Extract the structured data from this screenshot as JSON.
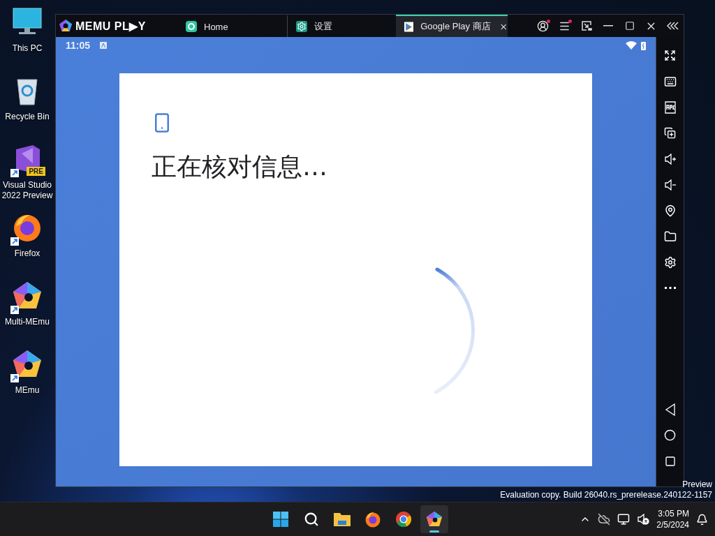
{
  "desktop_icons": [
    {
      "label": "This PC",
      "kind": "pc",
      "shortcut": false
    },
    {
      "label": "Recycle Bin",
      "kind": "bin",
      "shortcut": false
    },
    {
      "label": "Visual Studio 2022 Preview",
      "kind": "vs",
      "shortcut": true,
      "badge": "PRE"
    },
    {
      "label": "Firefox",
      "kind": "firefox",
      "shortcut": true
    },
    {
      "label": "Multi-MEmu",
      "kind": "multimemu",
      "shortcut": true
    },
    {
      "label": "MEmu",
      "kind": "memu",
      "shortcut": true
    }
  ],
  "emulator": {
    "logo": "MEMU PL▶Y",
    "tabs": [
      {
        "label": "Home",
        "kind": "home",
        "selected": false
      },
      {
        "label": "设置",
        "kind": "settings",
        "selected": false
      },
      {
        "label": "Google Play 商店",
        "kind": "play",
        "selected": true
      }
    ],
    "title_buttons": [
      {
        "kind": "account",
        "badge": true
      },
      {
        "kind": "menu",
        "badge": true
      },
      {
        "kind": "screen",
        "badge": false
      },
      {
        "kind": "minimize",
        "badge": false
      },
      {
        "kind": "maximize",
        "badge": false
      },
      {
        "kind": "close",
        "badge": false
      },
      {
        "kind": "collapse",
        "badge": false
      }
    ],
    "status_bar": {
      "time": "11:05"
    },
    "dialog": {
      "title": "正在核对信息…"
    },
    "tools": [
      {
        "kind": "fullscreen"
      },
      {
        "kind": "keyboard"
      },
      {
        "kind": "apk"
      },
      {
        "kind": "multi"
      },
      {
        "kind": "volume-up"
      },
      {
        "kind": "volume-down"
      },
      {
        "kind": "location"
      },
      {
        "kind": "folder"
      },
      {
        "kind": "settings"
      },
      {
        "kind": "more"
      }
    ],
    "nav_buttons": [
      {
        "kind": "back"
      },
      {
        "kind": "home"
      },
      {
        "kind": "recents"
      }
    ]
  },
  "system_notice": [
    "Preview",
    "Evaluation copy. Build 26040.rs_prerelease.240122-1157"
  ],
  "taskbar": {
    "apps": [
      {
        "kind": "start",
        "selected": false
      },
      {
        "kind": "search",
        "selected": false
      },
      {
        "kind": "explorer",
        "selected": false
      },
      {
        "kind": "firefox",
        "selected": false
      },
      {
        "kind": "chrome",
        "selected": false
      },
      {
        "kind": "memu",
        "selected": true
      }
    ],
    "time": "3:05 PM",
    "date": "2/5/2024"
  }
}
